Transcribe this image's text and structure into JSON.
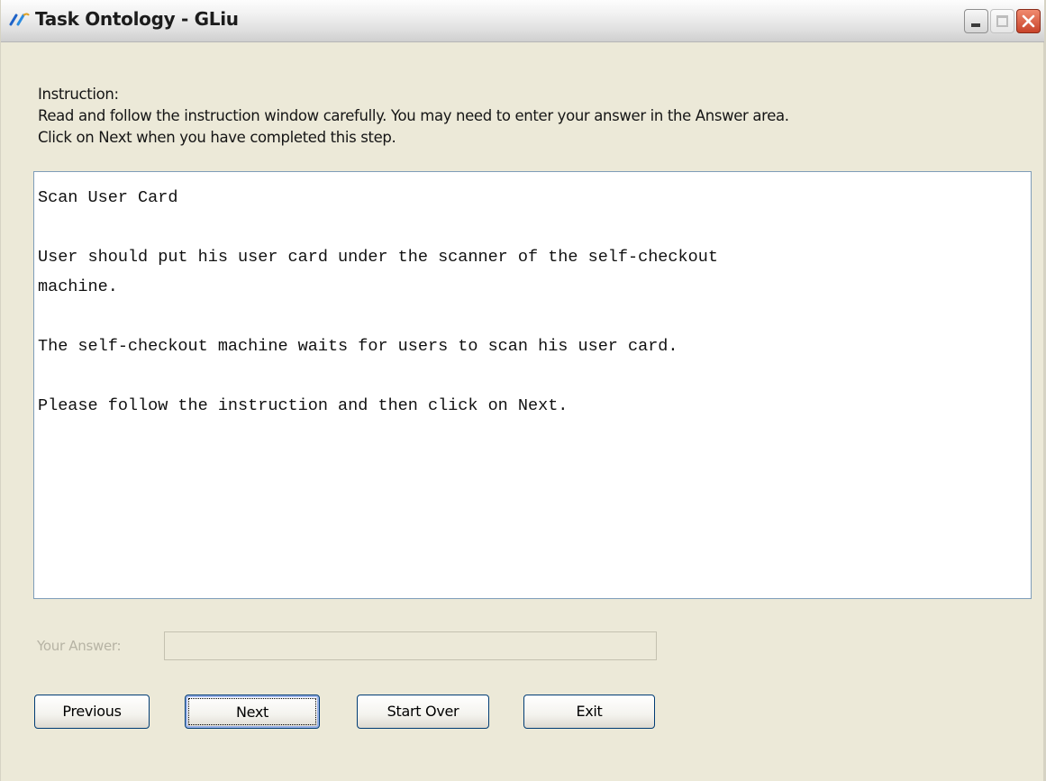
{
  "window": {
    "title": "Task Ontology - GLiu"
  },
  "instruction": {
    "label": "Instruction:",
    "line1": "Read and follow the instruction window carefully. You may need to enter your answer in the Answer area.",
    "line2": "Click on Next when you have completed this step."
  },
  "content": {
    "lines": [
      "Scan User Card",
      "",
      "User should put his user card under the scanner of the self-checkout",
      "machine.",
      "",
      "The self-checkout machine waits for users to scan his user card.",
      "",
      "Please follow the instruction and then click on Next."
    ]
  },
  "answer": {
    "label": "Your Answer:",
    "value": ""
  },
  "buttons": {
    "previous": "Previous",
    "next": "Next",
    "start_over": "Start Over",
    "exit": "Exit"
  },
  "icons": {
    "app": "app-logo-icon",
    "minimize": "minimize-icon",
    "maximize": "maximize-icon",
    "close": "close-icon"
  },
  "colors": {
    "window_bg": "#ece9d8",
    "close_button": "#c8432a",
    "button_border": "#003c74"
  }
}
